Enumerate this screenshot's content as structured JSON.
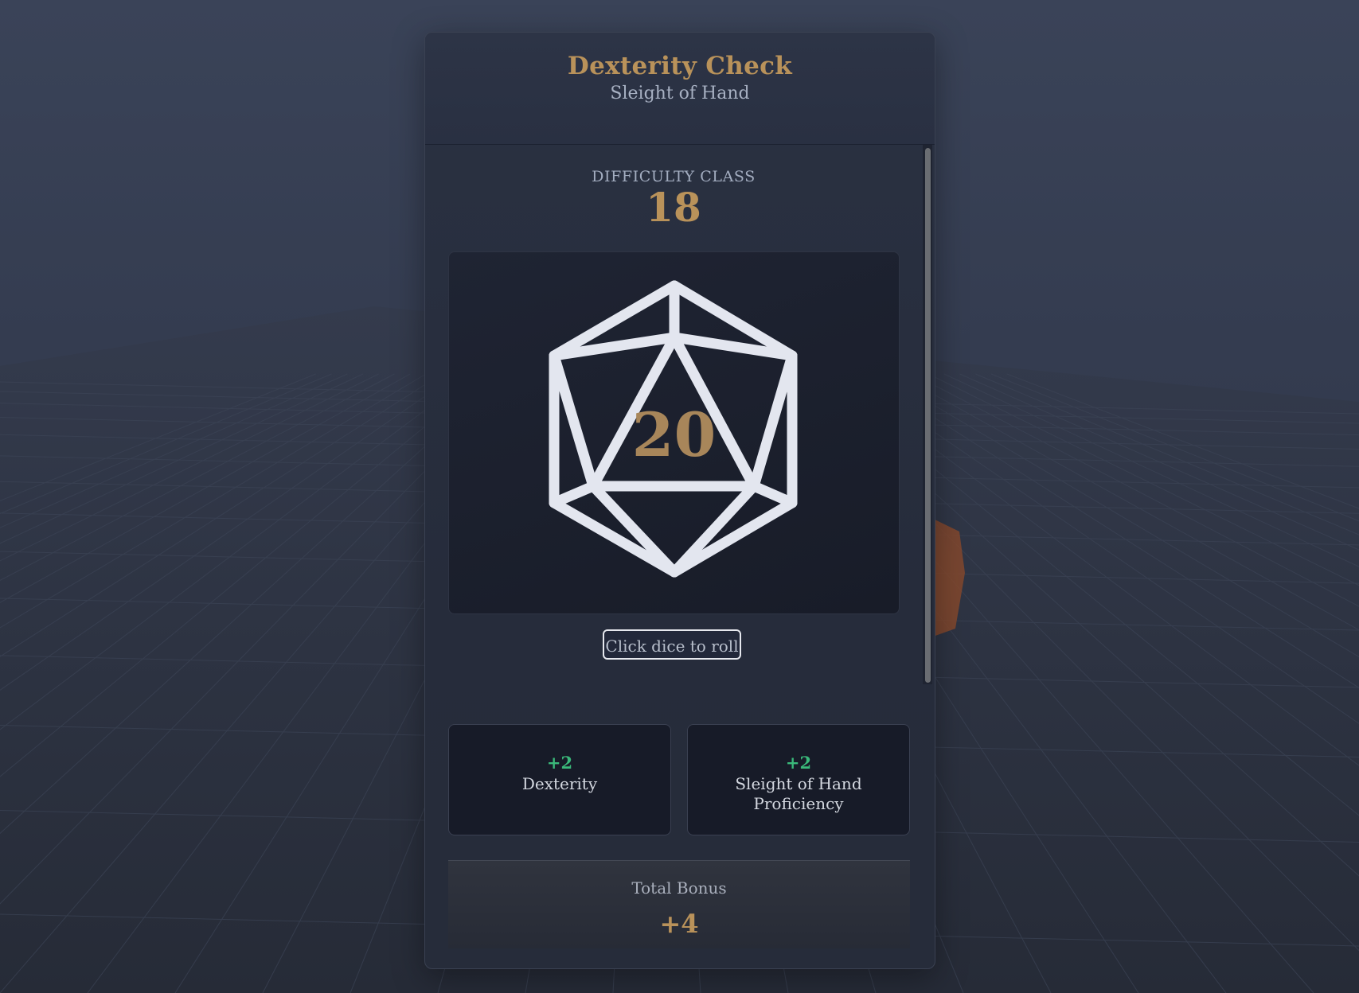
{
  "check": {
    "title": "Dexterity Check",
    "subtitle": "Sleight of Hand"
  },
  "difficulty": {
    "label": "DIFFICULTY CLASS",
    "value": "18"
  },
  "dice": {
    "face_value": "20",
    "icon": "d20-icon",
    "roll_button_label": "Click dice to roll"
  },
  "modifiers": [
    {
      "value": "+2",
      "name": "Dexterity"
    },
    {
      "value": "+2",
      "name": "Sleight of Hand Proficiency"
    }
  ],
  "total": {
    "label": "Total Bonus",
    "value": "+4"
  },
  "colors": {
    "gold": "#b9925a",
    "green": "#3ab87a",
    "background": "#2a3040"
  }
}
